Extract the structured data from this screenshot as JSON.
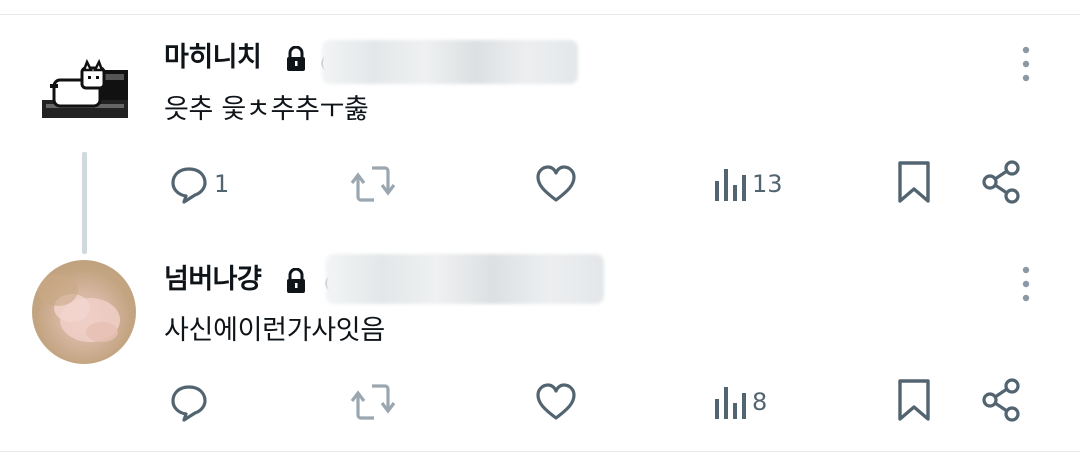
{
  "tweets": [
    {
      "name": "마히니치",
      "handle_prefix": "@",
      "text": "읏추 읓ㅊ추추ㅜ춣",
      "actions": {
        "reply_count": "1",
        "retweet_count": "",
        "like_count": "",
        "views_count": "13"
      },
      "avatar": "pixel-cat-computer-icon"
    },
    {
      "name": "넘버나걍",
      "handle_prefix": "@",
      "text": "사신에이런가사잇음",
      "actions": {
        "reply_count": "",
        "retweet_count": "",
        "like_count": "",
        "views_count": "8"
      },
      "avatar": "photo-avatar"
    }
  ],
  "colors": {
    "text_primary": "#0f1419",
    "text_secondary": "#536471",
    "thread_line": "#cfd9de",
    "divider": "#e6e9ec"
  },
  "icons": [
    "lock-icon",
    "more-vertical-icon",
    "reply-icon",
    "retweet-icon",
    "like-icon",
    "views-icon",
    "bookmark-icon",
    "share-icon"
  ]
}
